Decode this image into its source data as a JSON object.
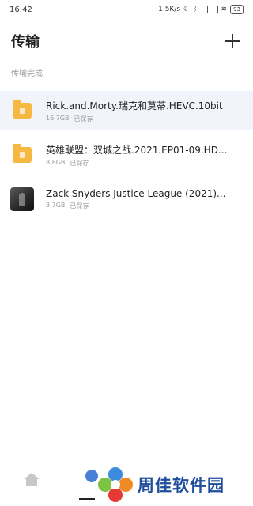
{
  "status_bar": {
    "time": "16:42",
    "net_speed": "1.5K/s",
    "battery": "93"
  },
  "header": {
    "title": "传输"
  },
  "section": {
    "label": "传输完成"
  },
  "files": [
    {
      "name": "Rick.and.Morty.瑞克和莫蒂.HEVC.10bit",
      "size": "16.7GB",
      "status": "已保存",
      "icon": "folder-icon"
    },
    {
      "name": "英雄联盟：双城之战.2021.EP01-09.HD...",
      "size": "8.8GB",
      "status": "已保存",
      "icon": "folder-icon"
    },
    {
      "name": "Zack Snyders Justice League (2021)...",
      "size": "3.7GB",
      "status": "已保存",
      "icon": "video-thumbnail"
    }
  ],
  "watermark": {
    "text": "周佳软件园"
  }
}
